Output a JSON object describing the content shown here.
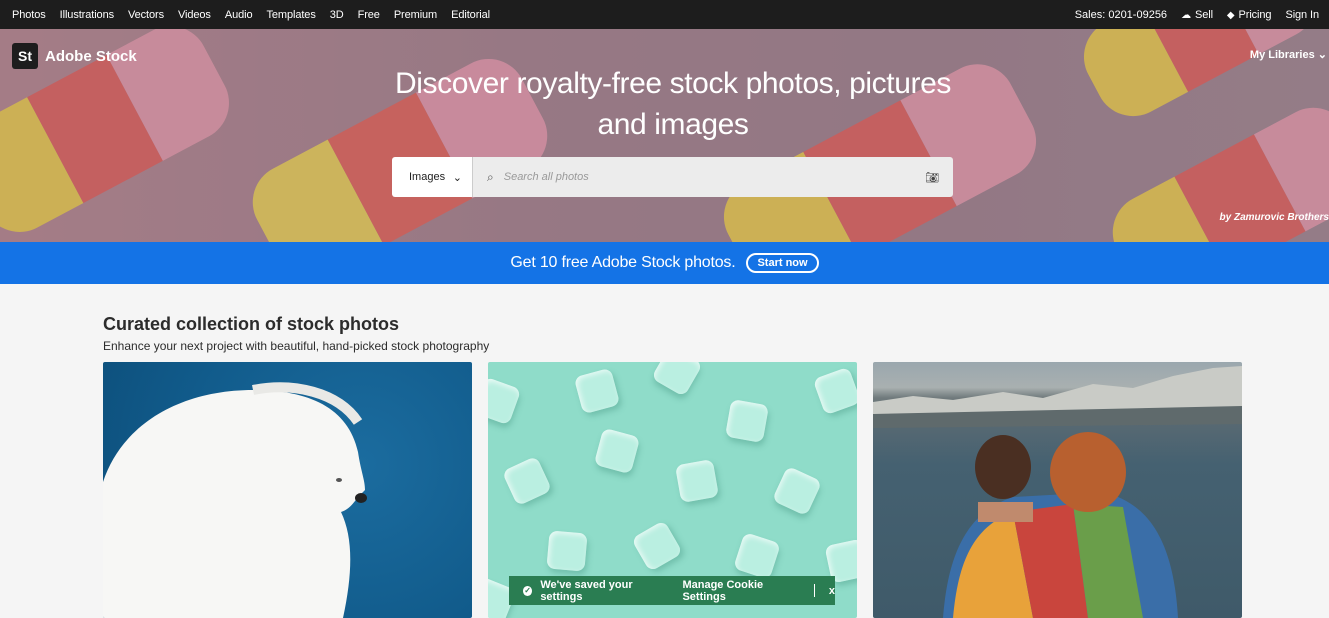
{
  "topnav": {
    "left_items": [
      "Photos",
      "Illustrations",
      "Vectors",
      "Videos",
      "Audio",
      "Templates",
      "3D",
      "Free",
      "Premium",
      "Editorial"
    ],
    "sales": "Sales: 0201-09256",
    "sell": "Sell",
    "pricing": "Pricing",
    "signin": "Sign In"
  },
  "hero": {
    "logo_mark": "St",
    "logo_name": "Adobe Stock",
    "my_libraries": "My Libraries",
    "title_line1": "Discover royalty-free stock photos, pictures",
    "title_line2": "and images",
    "byline": "by Zamurovic Brothers",
    "search": {
      "type_selected": "Images",
      "placeholder": "Search all photos"
    }
  },
  "promo": {
    "text": "Get 10 free Adobe Stock photos.",
    "button": "Start now"
  },
  "main": {
    "heading": "Curated collection of stock photos",
    "subheading": "Enhance your next project with beautiful, hand-picked stock photography"
  },
  "cookie": {
    "message": "We've saved your settings",
    "manage": "Manage Cookie Settings",
    "close": "x"
  },
  "colors": {
    "nav_bg": "#1d1d1d",
    "promo_blue": "#1473e6",
    "cookie_green": "#2a7d52"
  }
}
